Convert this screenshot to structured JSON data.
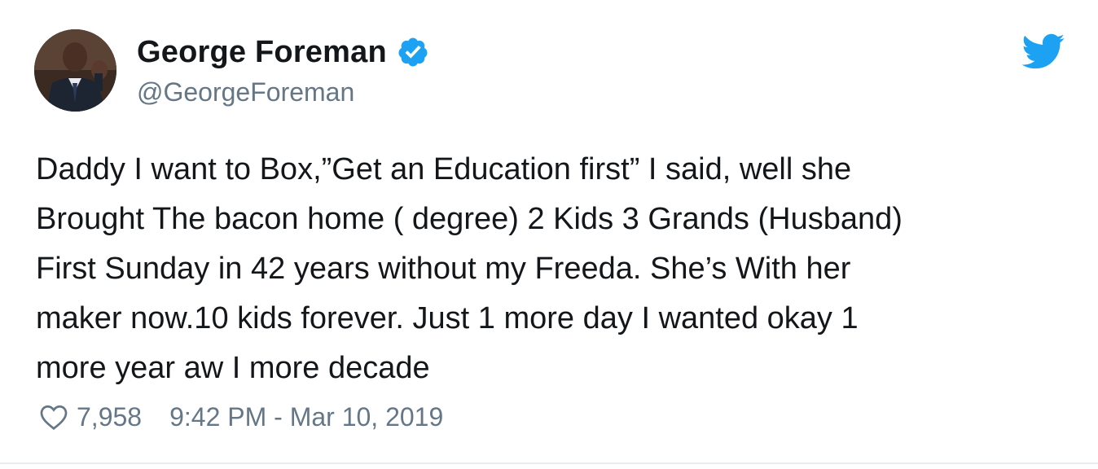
{
  "tweet": {
    "author": {
      "display_name": "George Foreman",
      "handle": "@GeorgeForeman",
      "verified": true,
      "avatar_icon": "profile-photo"
    },
    "text": "Daddy I want to Box,”Get an Education first” I said, well she\nBrought The bacon home ( degree) 2 Kids 3 Grands (Husband)\nFirst Sunday in 42 years without my Freeda. She’s With her\nmaker now.10 kids forever. Just 1 more day I wanted okay 1\nmore year aw I more decade",
    "likes": "7,958",
    "timestamp": "9:42 PM - Mar 10, 2019"
  },
  "icons": {
    "verified": "verified-badge-icon",
    "brand": "twitter-bird-icon",
    "like": "heart-outline-icon"
  },
  "colors": {
    "brand_blue": "#1da1f2",
    "text_primary": "#14171a",
    "text_secondary": "#657786"
  }
}
